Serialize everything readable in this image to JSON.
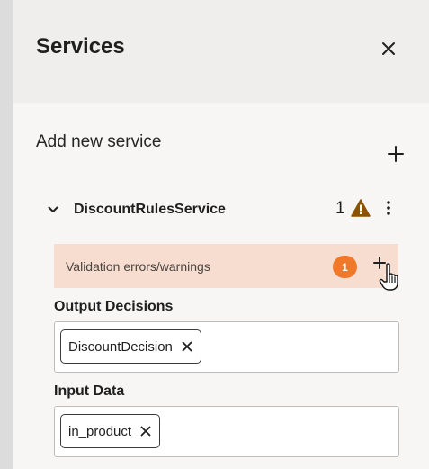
{
  "panel": {
    "title": "Services",
    "add_new_label": "Add new service"
  },
  "service": {
    "name": "DiscountRulesService",
    "warning_count": "1",
    "validation": {
      "label": "Validation errors/warnings",
      "badge_count": "1"
    },
    "output_decisions": {
      "label": "Output Decisions",
      "chips": [
        "DiscountDecision"
      ]
    },
    "input_data": {
      "label": "Input Data",
      "chips": [
        "in_product"
      ]
    }
  },
  "colors": {
    "warning": "#8a5300",
    "badge": "#f0782a",
    "validation_bg": "#f6ddd0"
  },
  "icons": [
    "close-icon",
    "plus-icon",
    "chevron-down-icon",
    "warning-icon",
    "kebab-menu-icon",
    "hand-cursor-icon",
    "remove-icon"
  ]
}
